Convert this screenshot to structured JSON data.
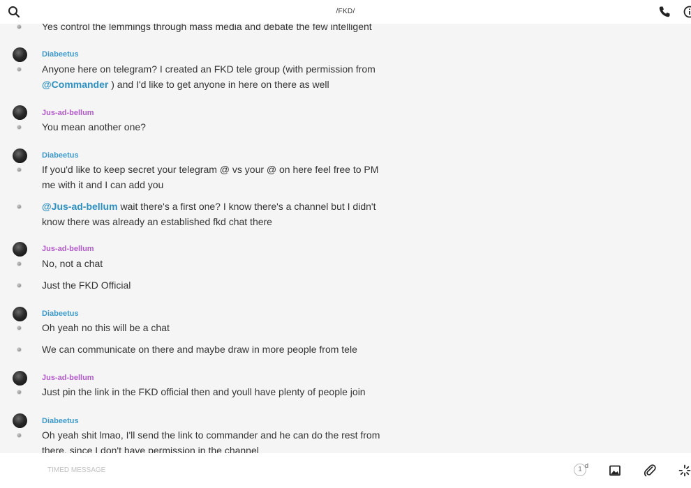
{
  "header": {
    "title": "/FKD/",
    "search_icon": "search-icon",
    "call_icon": "phone-icon",
    "info_icon": "info-icon"
  },
  "messages": [
    {
      "author": "",
      "text": "Yes control the lemmings through mass media and debate the few intelligent"
    },
    {
      "author": "Diabeetus",
      "author_color": "#3f9bcb",
      "pre": "Anyone here on telegram? I created an FKD tele group (with permission from",
      "mention": "@Commander",
      "post": " ) and I'd like to get anyone in here on there as well"
    },
    {
      "author": "Jus-ad-bellum",
      "author_color": "#b05ac8",
      "text": "You mean another one?"
    },
    {
      "author": "Diabeetus",
      "author_color": "#3f9bcb",
      "text": "If you'd like to keep secret your telegram @ vs your @ on here feel free to PM me with it and I can add you"
    },
    {
      "author": "",
      "mention": "@Jus-ad-bellum",
      "post": " wait there's a first one? I know there's a channel but I didn't know there was already an established fkd chat there"
    },
    {
      "author": "Jus-ad-bellum",
      "author_color": "#b05ac8",
      "text": "No, not a chat"
    },
    {
      "author": "",
      "text": "Just the FKD Official"
    },
    {
      "author": "Diabeetus",
      "author_color": "#3f9bcb",
      "text": "Oh yeah no this will be a chat"
    },
    {
      "author": "",
      "text": "We can communicate on there and maybe draw in more people from tele"
    },
    {
      "author": "Jus-ad-bellum",
      "author_color": "#b05ac8",
      "text": "Just pin the link in the FKD official then and youll have plenty of people join"
    },
    {
      "author": "Diabeetus",
      "author_color": "#3f9bcb",
      "text": "Oh yeah shit lmao, I'll send the link to commander and he can do the rest from there, since I don't have permission in the channel"
    }
  ],
  "composer": {
    "placeholder": "TIMED MESSAGE",
    "timer_value": "1",
    "timer_unit": "d",
    "image_icon": "image-icon",
    "attach_icon": "paperclip-icon",
    "loading_icon": "spinner-icon"
  }
}
